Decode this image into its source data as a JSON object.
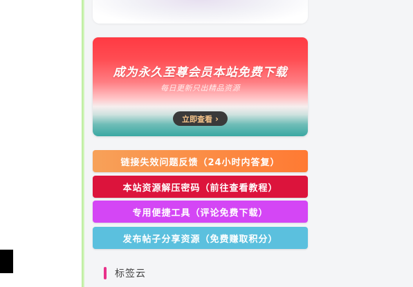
{
  "promo": {
    "title": "成为永久至尊会员本站免费下载",
    "subtitle": "每日更新只出精品资源",
    "cta_label": "立即查看",
    "cta_icon": "chevron-right-icon"
  },
  "links": [
    {
      "label": "链接失效问题反馈（24小时内答复）",
      "color": "#ff7a33"
    },
    {
      "label": "本站资源解压密码（前往查看教程）",
      "color": "#dc143c"
    },
    {
      "label": "专用便捷工具（评论免费下载）",
      "color": "#d446f5"
    },
    {
      "label": "发布帖子分享资源（免费赚取积分）",
      "color": "#5bc0de"
    }
  ],
  "tag_cloud": {
    "title": "标签云",
    "accent": "#e8318a"
  }
}
